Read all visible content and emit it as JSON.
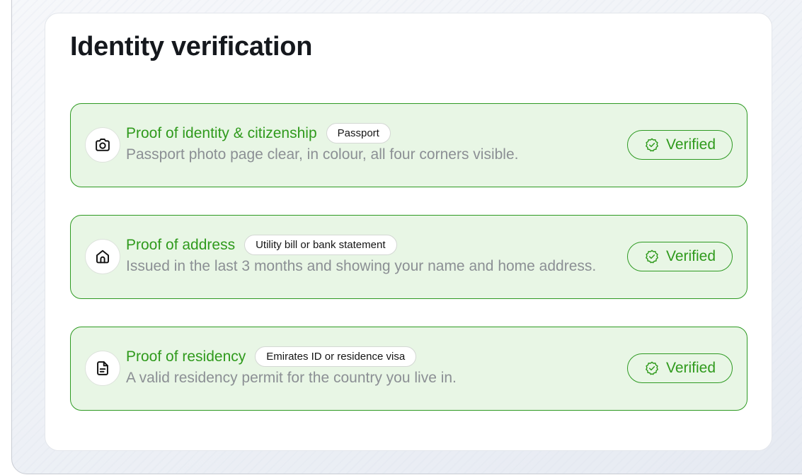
{
  "card": {
    "title": "Identity verification"
  },
  "documents": [
    {
      "title": "Proof of identity & citizenship",
      "tag": "Passport",
      "description": "Passport photo page clear, in colour, all four corners visible.",
      "icon": "camera-icon",
      "status": "Verified"
    },
    {
      "title": "Proof of address",
      "tag": "Utility bill or bank statement",
      "description": "Issued in the last 3 months and showing your name and home address.",
      "icon": "home-icon",
      "status": "Verified"
    },
    {
      "title": "Proof of residency",
      "tag": "Emirates ID or residence visa",
      "description": "A valid residency permit for the country you live in.",
      "icon": "document-icon",
      "status": "Verified"
    }
  ],
  "colors": {
    "accent_green": "#2f9a1c",
    "item_background": "#e8f6e5",
    "title_text": "#15181d",
    "muted_text": "#8b8f94"
  }
}
